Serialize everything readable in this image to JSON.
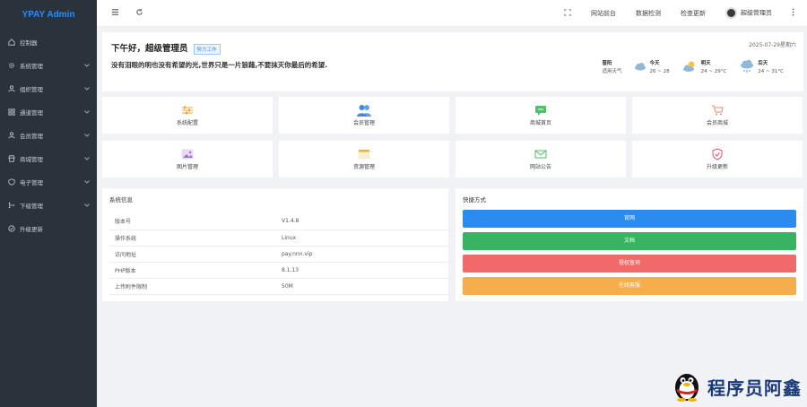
{
  "app": {
    "title": "YPAY Admin"
  },
  "sidebar": {
    "items": [
      {
        "label": "控制器",
        "icon": "home-icon",
        "has_children": false
      },
      {
        "label": "系统管理",
        "icon": "gear-icon",
        "has_children": true
      },
      {
        "label": "组织管理",
        "icon": "user-icon",
        "has_children": true
      },
      {
        "label": "通道管理",
        "icon": "grid-icon",
        "has_children": true
      },
      {
        "label": "会员管理",
        "icon": "user-icon",
        "has_children": true
      },
      {
        "label": "商城管理",
        "icon": "store-icon",
        "has_children": true
      },
      {
        "label": "电子管理",
        "icon": "shield-icon",
        "has_children": true
      },
      {
        "label": "下级管理",
        "icon": "branch-icon",
        "has_children": true
      },
      {
        "label": "升级更新",
        "icon": "check-circle-icon",
        "has_children": false
      }
    ]
  },
  "topbar": {
    "links": [
      "网站前台",
      "数据检测",
      "检查更新"
    ],
    "user": "超级管理员"
  },
  "welcome": {
    "greeting": "下午好，超级管理员",
    "tag": "努力工作",
    "motto": "没有泪眼的明也没有希望的光,世界只是一片狼藉,不要抹灭你最后的希望.",
    "date": "2025-07-29星期六",
    "weather": [
      {
        "title": "晋阳",
        "line2": "适用天气",
        "icon": "none"
      },
      {
        "title": "今天",
        "line2": "26 ~ 28",
        "icon": "cloud-icon"
      },
      {
        "title": "明天",
        "line2": "24 ~ 29°C",
        "icon": "sun-cloud-icon"
      },
      {
        "title": "后天",
        "line2": "24 ~ 31°C",
        "icon": "rain-cloud-icon"
      }
    ]
  },
  "tiles": [
    {
      "label": "系统配置",
      "icon": "sliders-icon",
      "color": "#f0a33a"
    },
    {
      "label": "会员管理",
      "icon": "users-icon",
      "color": "#3f88e6"
    },
    {
      "label": "商城首页",
      "icon": "chat-icon",
      "color": "#4cc36b"
    },
    {
      "label": "会员商城",
      "icon": "cart-icon",
      "color": "#f08a5d"
    },
    {
      "label": "图片管理",
      "icon": "image-icon",
      "color": "#a66bd8"
    },
    {
      "label": "资源管理",
      "icon": "window-icon",
      "color": "#f0b429"
    },
    {
      "label": "网站公告",
      "icon": "mail-icon",
      "color": "#4cc36b"
    },
    {
      "label": "升级更新",
      "icon": "shield-check-icon",
      "color": "#e94d6a"
    }
  ],
  "system_info": {
    "title": "系统信息",
    "rows": [
      {
        "key": "版本号",
        "value": "V1.4.8"
      },
      {
        "key": "操作系统",
        "value": "Linux"
      },
      {
        "key": "访问地址",
        "value": "pay.nnn.vip"
      },
      {
        "key": "PHP版本",
        "value": "8.1.13"
      },
      {
        "key": "上传附件限制",
        "value": "50M"
      }
    ]
  },
  "quick": {
    "title": "快捷方式",
    "buttons": [
      {
        "label": "官网",
        "color": "#2b8cf0"
      },
      {
        "label": "文档",
        "color": "#38b361"
      },
      {
        "label": "授权查询",
        "color": "#f06a6a"
      },
      {
        "label": "在线客服",
        "color": "#f6ad4c"
      }
    ]
  },
  "brand": {
    "text": "程序员阿鑫"
  }
}
